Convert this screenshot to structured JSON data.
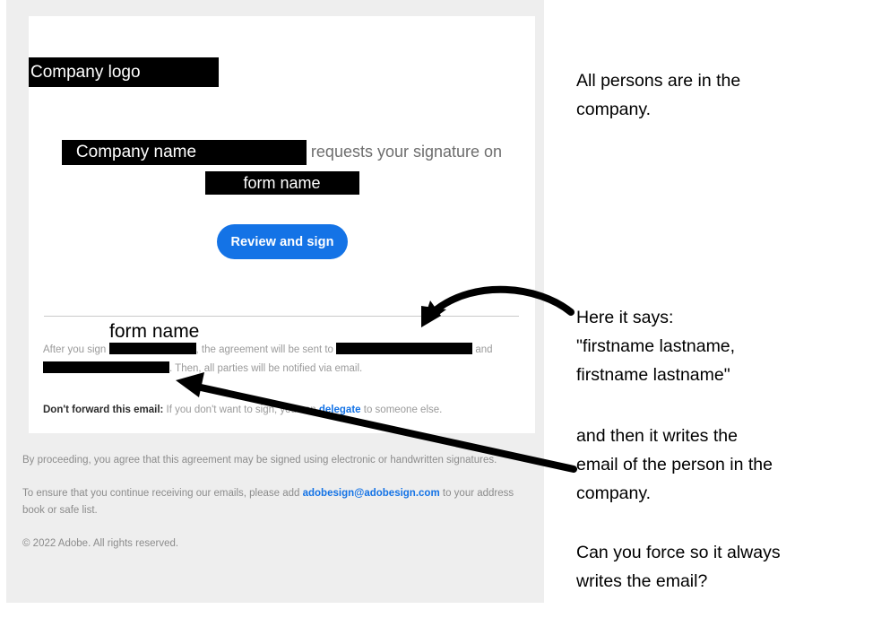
{
  "email": {
    "logo_placeholder": "Company logo",
    "request": {
      "company_name_placeholder": "Company name",
      "requests_text": "requests your signature on",
      "form_name_placeholder": "form name"
    },
    "cta_button_label": "Review and sign",
    "sign_paragraph": {
      "part1": "After you sign",
      "part2": ", the agreement will be sent to",
      "part3": "and",
      "part4": ". Then, all parties will be notified via email."
    },
    "no_forward": {
      "bold_lead": "Don't forward this email:",
      "text_before_link": " If you don't want to sign, you can ",
      "link_label": "delegate",
      "text_after_link": " to someone else."
    },
    "footer": {
      "line1": "By proceeding, you agree that this agreement may be signed using electronic or handwritten signatures.",
      "line2_before_link": "To ensure that you continue receiving our emails, please add ",
      "line2_link": "adobesign@adobesign.com",
      "line2_after_link": " to your address book or safe list.",
      "copyright": "© 2022 Adobe. All rights reserved."
    }
  },
  "annotations": {
    "overlay_form_name": "form name",
    "note1": "All persons are in the\ncompany.",
    "note2": "Here it says:\n\"firstname lastname,\nfirstname lastname\"",
    "note3": "and then it writes the\nemail of the person in the\ncompany.",
    "note4": "Can you force so it always\nwrites the email?"
  },
  "colors": {
    "accent_blue": "#1473e6",
    "panel_gray": "#eeeeee",
    "body_text_gray": "#9a9a9a",
    "redaction_black": "#000000"
  }
}
